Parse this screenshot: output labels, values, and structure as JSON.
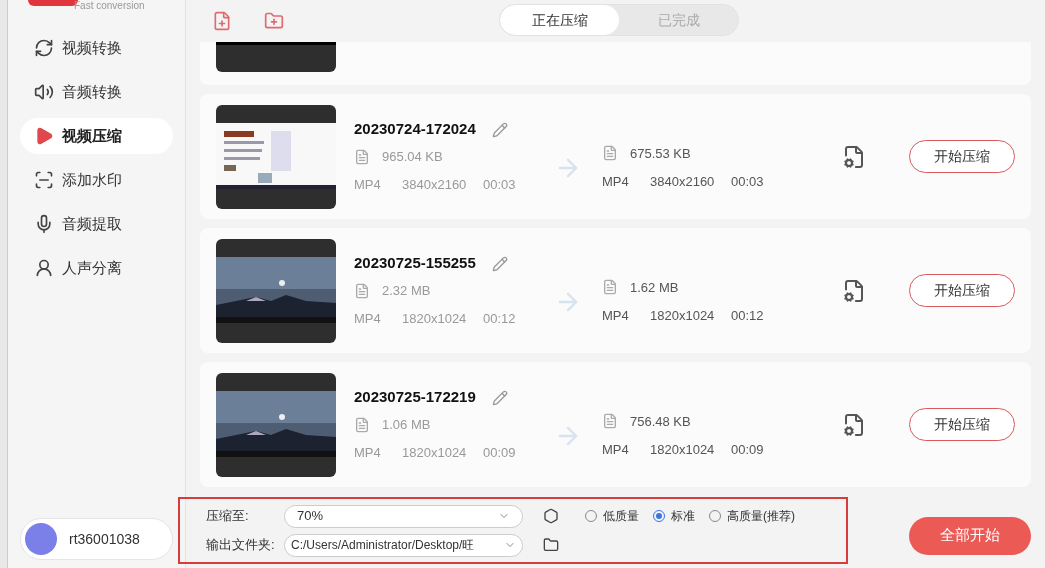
{
  "brand": {
    "tagline": "Fast conversion"
  },
  "sidebar": {
    "items": [
      {
        "label": "视频转换",
        "selected": false
      },
      {
        "label": "音频转换",
        "selected": false
      },
      {
        "label": "视频压缩",
        "selected": true
      },
      {
        "label": "添加水印",
        "selected": false
      },
      {
        "label": "音频提取",
        "selected": false
      },
      {
        "label": "人声分离",
        "selected": false
      }
    ],
    "user": {
      "name": "rt36001038"
    }
  },
  "tabs": [
    {
      "label": "正在压缩",
      "selected": true
    },
    {
      "label": "已完成",
      "selected": false
    }
  ],
  "files": [
    {
      "name": "20230724-172024",
      "source": {
        "size": "965.04 KB",
        "format": "MP4",
        "resolution": "3840x2160",
        "duration": "00:03"
      },
      "output": {
        "size": "675.53 KB",
        "format": "MP4",
        "resolution": "3840x2160",
        "duration": "00:03"
      },
      "action": "开始压缩"
    },
    {
      "name": "20230725-155255",
      "source": {
        "size": "2.32 MB",
        "format": "MP4",
        "resolution": "1820x1024",
        "duration": "00:12"
      },
      "output": {
        "size": "1.62 MB",
        "format": "MP4",
        "resolution": "1820x1024",
        "duration": "00:12"
      },
      "action": "开始压缩"
    },
    {
      "name": "20230725-172219",
      "source": {
        "size": "1.06 MB",
        "format": "MP4",
        "resolution": "1820x1024",
        "duration": "00:09"
      },
      "output": {
        "size": "756.48 KB",
        "format": "MP4",
        "resolution": "1820x1024",
        "duration": "00:09"
      },
      "action": "开始压缩"
    }
  ],
  "settings": {
    "compress_label": "压缩至:",
    "compress_value": "70%",
    "quality": [
      {
        "label": "低质量",
        "selected": false
      },
      {
        "label": "标准",
        "selected": true
      },
      {
        "label": "高质量(推荐)",
        "selected": false
      }
    ],
    "output_label": "输出文件夹:",
    "output_value": "C:/Users/Administrator/Desktop/旺",
    "highlighted": true
  },
  "start_all": "全部开始"
}
